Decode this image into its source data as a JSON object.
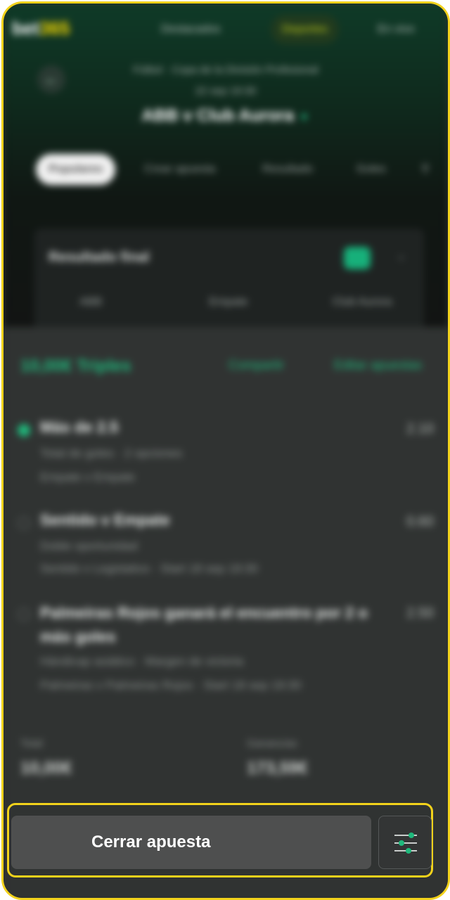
{
  "header": {
    "logo": {
      "prefix": "bet",
      "suffix": "365"
    },
    "nav": [
      "Destacados",
      "Deportes",
      "En vivo"
    ],
    "breadcrumb": "Fútbol · Copa de la División Profesional",
    "date": "22 sep 19:30",
    "match_title": "ABB v Club Aurora"
  },
  "tabs": [
    "Populares",
    "Crear apuesta",
    "Resultado",
    "Goles"
  ],
  "market_card": {
    "title": "Resultado final",
    "columns": [
      "ABB",
      "Empate",
      "Club Aurora"
    ]
  },
  "bet_slip": {
    "combo_label": "10,00€ Triples",
    "links": [
      "Compartir",
      "Editar apuestas"
    ],
    "selections": [
      {
        "title": "Más de 2.5",
        "sub1": "Total de goles · 2 opciones",
        "sub2": "Empate v Empate",
        "odds": "2.10"
      },
      {
        "title": "Sentido v Empate",
        "sub1": "Doble oportunidad",
        "sub2": "Sentido v Legislativo · Start 18 sep 19:30",
        "odds": "0.60"
      },
      {
        "title": "Palmeiras Rojos ganará el encuentro por 2 o más goles",
        "sub1": "Hándicap asiático · Margen de victoria",
        "sub2": "Palmeiras v Palmeiras Rojos · Start 18 sep 19:30",
        "odds": "2.50"
      }
    ],
    "stake_label": "Total",
    "stake_value": "10,00€",
    "returns_label": "Ganancias",
    "returns_value": "173,59€"
  },
  "actions": {
    "close_bet_label": "Cerrar apuesta",
    "settings_icon": "sliders-icon"
  },
  "colors": {
    "frame_highlight": "#f2d21b",
    "accent": "#1fb97c",
    "button_bg": "#4e4f4f"
  }
}
